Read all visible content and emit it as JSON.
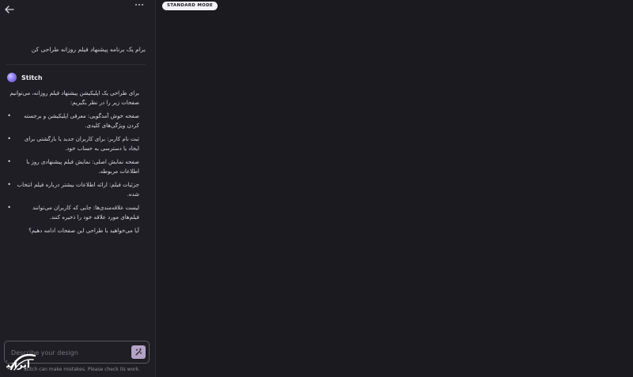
{
  "app": {
    "mode_badge": "STANDARD MODE",
    "accent_color": "#b4a3c7"
  },
  "topbar": {
    "back_icon": "arrow-left-icon",
    "more_icon": "more-horizontal-icon"
  },
  "conversation": {
    "user_message": "برام یک برنامه پیشنهاد فیلم روزانه طراحی کن",
    "assistant_name": "Stitch",
    "assistant_intro": "برای طراحی یک اپلیکیشن پیشنهاد فیلم روزانه، می‌توانیم صفحات زیر را در نظر بگیریم:",
    "items": [
      "صفحه خوش آمدگویی: معرفی اپلیکیشن و برجسته کردن ویژگی‌های کلیدی.",
      "ثبت نام کاربر: برای کاربران جدید یا بازگشتی برای ایجاد یا دسترسی به حساب خود.",
      "صفحه نمایش اصلی: نمایش فیلم پیشنهادی روز با اطلاعات مربوطه.",
      "جزئیات فیلم: ارائه اطلاعات بیشتر درباره فیلم انتخاب شده.",
      "لیست علاقه‌مندی‌ها: جایی که کاربران می‌توانند فیلم‌های مورد علاقه خود را ذخیره کنند."
    ],
    "closing": "آیا می‌خواهید با طراحی این صفحات ادامه دهیم؟"
  },
  "composer": {
    "placeholder": "Describe your design",
    "send_icon": "magic-wand-icon",
    "disclaimer": "Stitch can make mistakes. Please check its work."
  },
  "watermark": {
    "text": "ایرانیکارت"
  }
}
